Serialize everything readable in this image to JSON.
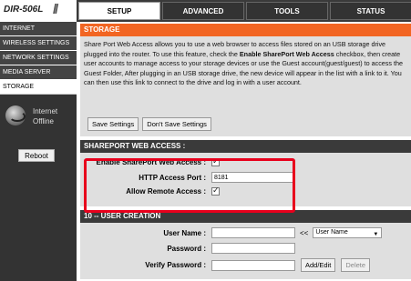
{
  "header": {
    "model": "DIR-506L",
    "tabs": [
      {
        "label": "SETUP",
        "active": true
      },
      {
        "label": "ADVANCED",
        "active": false
      },
      {
        "label": "TOOLS",
        "active": false
      },
      {
        "label": "STATUS",
        "active": false
      }
    ]
  },
  "sidebar": {
    "items": [
      {
        "label": "INTERNET",
        "active": false
      },
      {
        "label": "WIRELESS SETTINGS",
        "active": false
      },
      {
        "label": "NETWORK SETTINGS",
        "active": false
      },
      {
        "label": "MEDIA SERVER",
        "active": false
      },
      {
        "label": "STORAGE",
        "active": true
      }
    ],
    "internet_status": {
      "line1": "Internet",
      "line2": "Offline",
      "icon": "globe-icon"
    },
    "reboot_label": "Reboot"
  },
  "storage": {
    "title": "STORAGE",
    "intro_parts": [
      "Share Port Web Access allows you to use a web browser to access files stored on an USB storage drive plugged into the router. To use this feature, check the ",
      "Enable SharePort Web Access",
      " checkbox, then create user accounts to manage access to your storage devices or use the Guest account(guest/guest) to access the Guest Folder, After plugging in an USB storage drive, the new device will appear in the list with a link to it. You can then use this link to connect to the drive and log in with a user account."
    ],
    "save_label": "Save Settings",
    "dont_save_label": "Don't Save Settings"
  },
  "shareport": {
    "title": "SHAREPORT WEB ACCESS :",
    "enable_label": "Enable SharePort Web Access :",
    "enable_checked": true,
    "port_label": "HTTP Access Port :",
    "port_value": "8181",
    "remote_label": "Allow Remote Access :",
    "remote_checked": true
  },
  "user_creation": {
    "title": "10 -- USER CREATION",
    "username_label": "User Name :",
    "password_label": "Password :",
    "verify_label": "Verify Password :",
    "arrows": "<<",
    "select_value": "User Name",
    "add_edit_label": "Add/Edit",
    "delete_label": "Delete"
  },
  "colors": {
    "accent": "#f26522",
    "highlight": "#e8001c",
    "dark": "#3a3a3a"
  }
}
